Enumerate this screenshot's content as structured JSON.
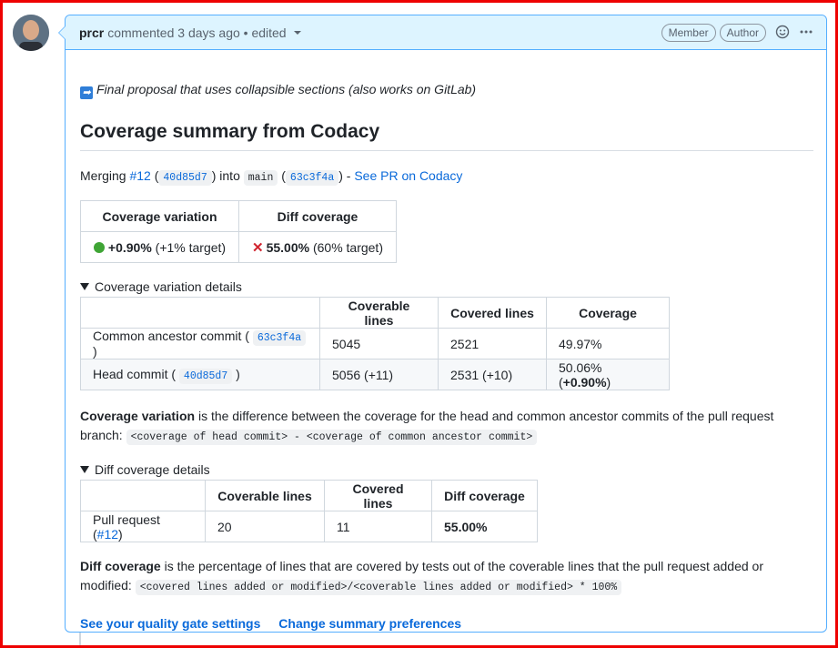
{
  "comment": {
    "author": "prcr",
    "meta": "commented 3 days ago • edited",
    "badges": [
      "Member",
      "Author"
    ]
  },
  "proposal_text": "Final proposal that uses collapsible sections (also works on GitLab)",
  "title": "Coverage summary from Codacy",
  "merge": {
    "prefix": "Merging",
    "pr": "#12",
    "sha_head": "40d85d7",
    "into": "into",
    "branch": "main",
    "sha_base": "63c3f4a",
    "link": "See PR on Codacy"
  },
  "summary_table": {
    "headers": [
      "Coverage variation",
      "Diff coverage"
    ],
    "variation_value": "+0.90%",
    "variation_target": "(+1% target)",
    "diff_value": "55.00%",
    "diff_target": "(60% target)"
  },
  "variation_details": {
    "summary": "Coverage variation details",
    "headers": [
      "",
      "Coverable lines",
      "Covered lines",
      "Coverage"
    ],
    "rows": [
      {
        "label": "Common ancestor commit (",
        "sha": "63c3f4a",
        "coverable": "5045",
        "covered": "2521",
        "coverage": "49.97%"
      },
      {
        "label": "Head commit (",
        "sha": "40d85d7",
        "coverable": "5056 (+11)",
        "covered": "2531 (+10)",
        "coverage": "50.06% (",
        "coverage_bold": "+0.90%",
        "coverage_end": ")"
      }
    ]
  },
  "variation_explain": {
    "bold": "Coverage variation",
    "text": " is the difference between the coverage for the head and common ancestor commits of the pull request branch: ",
    "code": "<coverage of head commit> - <coverage of common ancestor commit>"
  },
  "diff_details": {
    "summary": "Diff coverage details",
    "headers": [
      "",
      "Coverable lines",
      "Covered lines",
      "Diff coverage"
    ],
    "row": {
      "label": "Pull request (",
      "pr": "#12",
      "coverable": "20",
      "covered": "11",
      "diff": "55.00%"
    }
  },
  "diff_explain": {
    "bold": "Diff coverage",
    "text": " is the percentage of lines that are covered by tests out of the coverable lines that the pull request added or modified: ",
    "code": "<covered lines added or modified>/<coverable lines added or modified> * 100%"
  },
  "footer": {
    "link1": "See your quality gate settings",
    "link2": "Change summary preferences"
  },
  "colors": {
    "accent": "#0969da",
    "header_bg": "#ddf4ff",
    "border": "#54aeff",
    "frame": "#ee0000"
  }
}
